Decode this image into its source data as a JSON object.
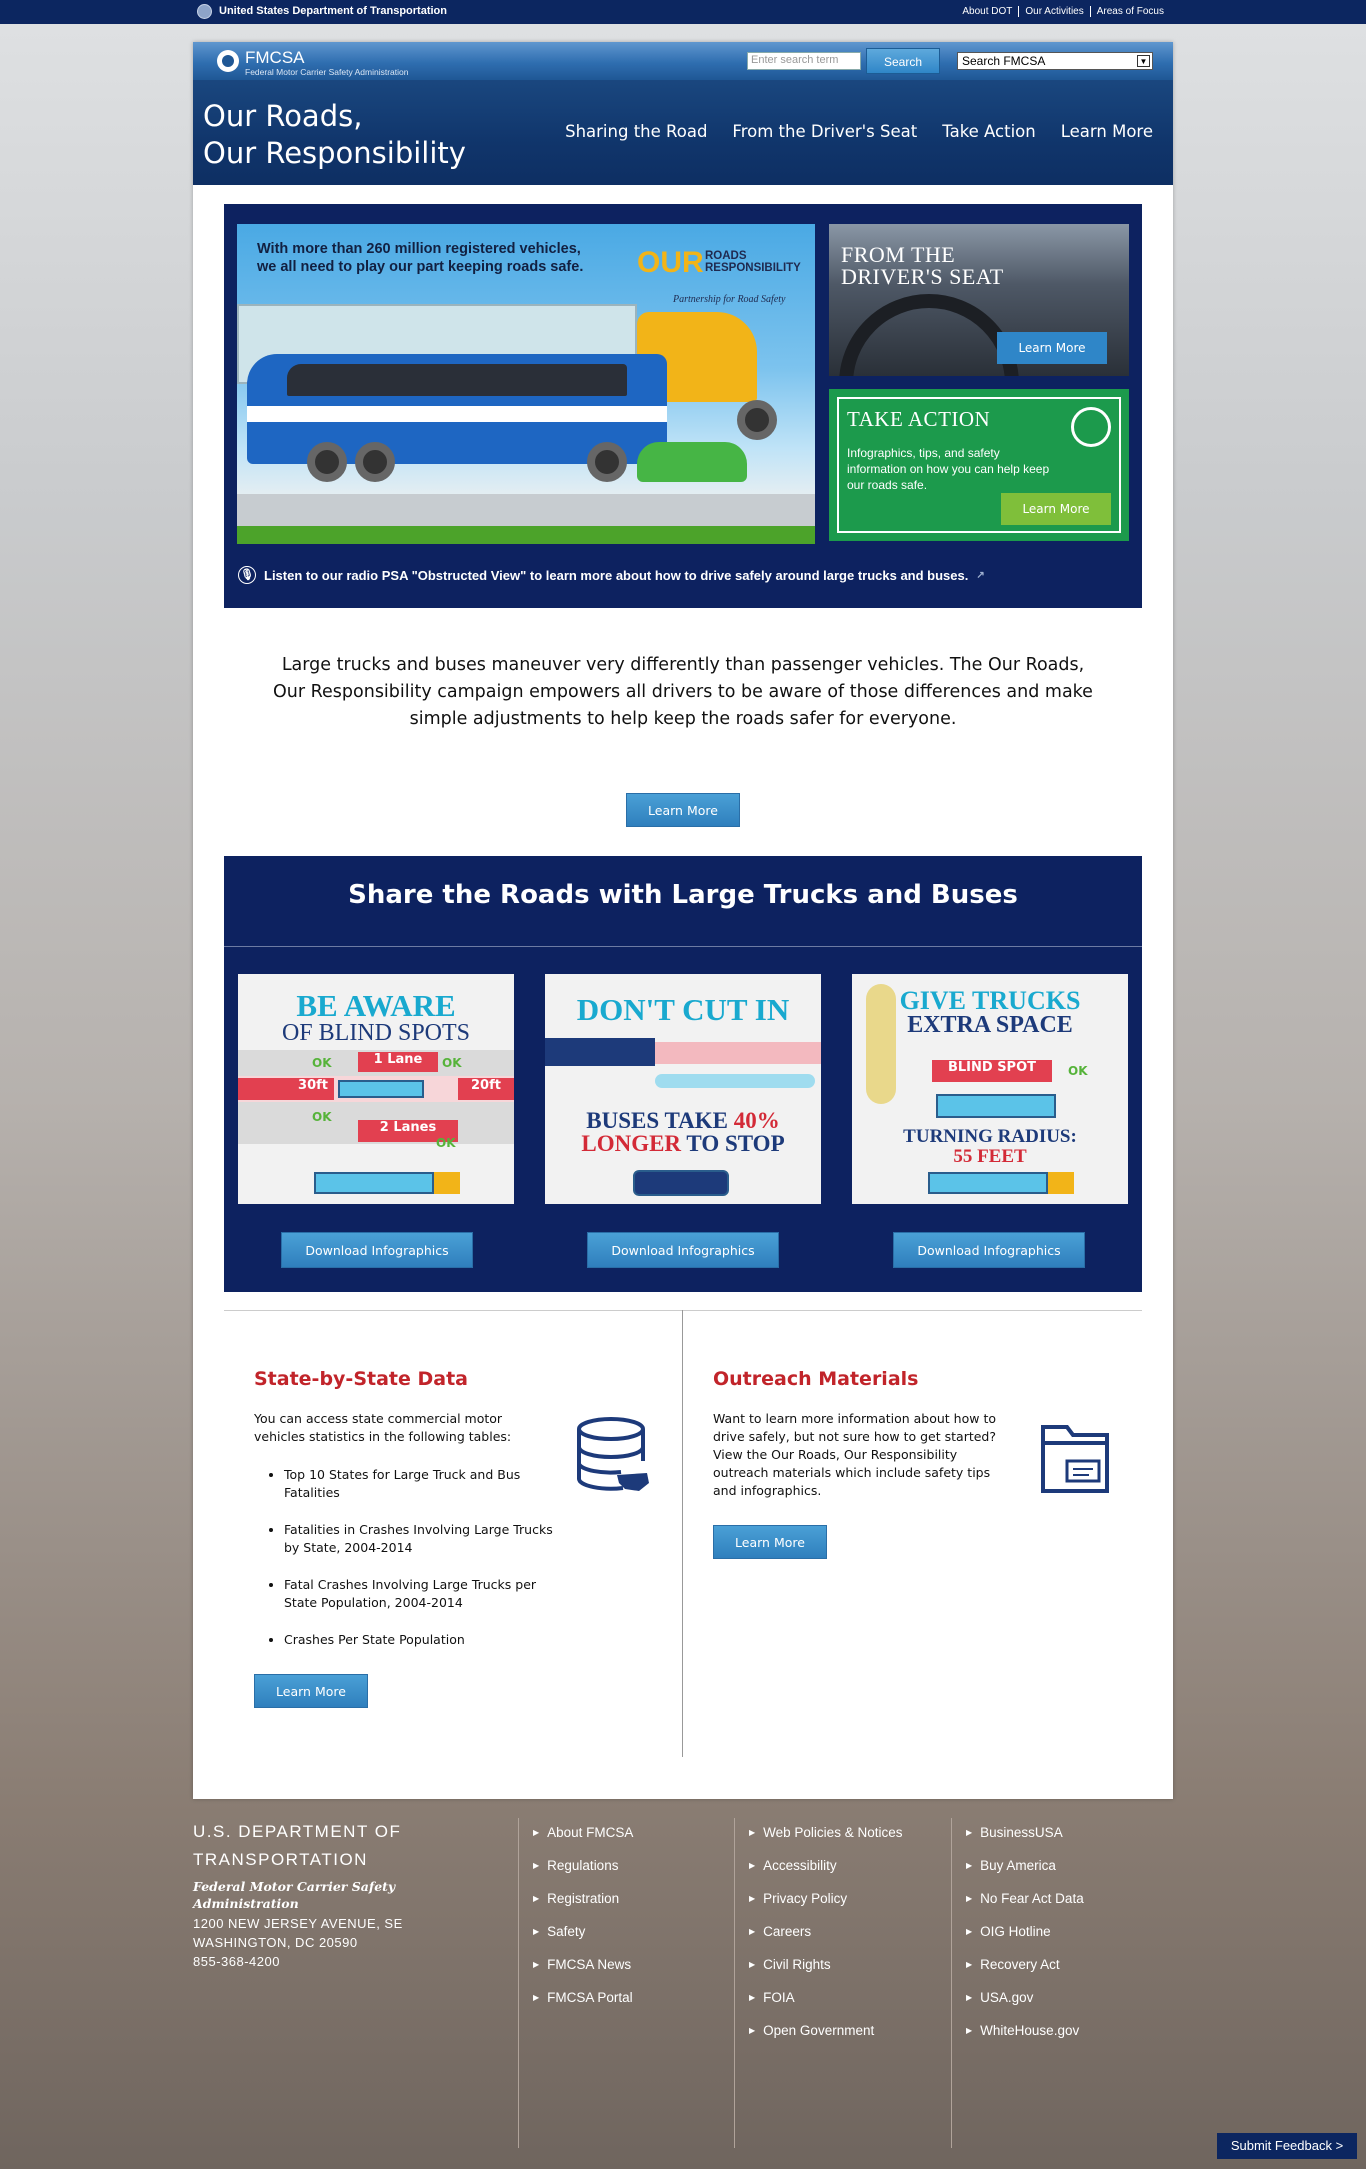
{
  "topbar": {
    "agency": "United States Department of Transportation",
    "links": [
      "About DOT",
      "Our Activities",
      "Areas of Focus"
    ]
  },
  "header": {
    "logo_title": "FMCSA",
    "logo_subtitle": "Federal Motor Carrier Safety Administration",
    "search_placeholder": "Enter search term",
    "search_button": "Search",
    "search_scope": "Search FMCSA"
  },
  "site": {
    "title_line1": "Our Roads,",
    "title_line2": "Our Responsibility"
  },
  "nav": [
    "Sharing the Road",
    "From the Driver's Seat",
    "Take Action",
    "Learn More"
  ],
  "hero": {
    "message_line1": "With more than 260 million registered vehicles,",
    "message_line2": "we all need to play our part keeping roads safe.",
    "badge_our": "OUR",
    "badge_roads": "ROADS",
    "badge_resp": "RESPONSIBILITY",
    "badge_partnership": "Partnership for Road Safety",
    "drivers_seat_title_1": "FROM THE",
    "drivers_seat_title_2": "DRIVER'S SEAT",
    "drivers_seat_button": "Learn More",
    "take_action_title": "TAKE ACTION",
    "take_action_desc": "Infographics, tips, and safety information on how you can help keep our roads safe.",
    "take_action_button": "Learn More",
    "audio_text": "Listen to our radio PSA \"Obstructed View\" to learn more about how to drive safely around large trucks and buses."
  },
  "intro": {
    "text": "Large trucks and buses maneuver very differently than passenger vehicles. The Our Roads, Our Responsibility campaign empowers all drivers to be aware of those differences and make simple adjustments to help keep the roads safer for everyone.",
    "button": "Learn More"
  },
  "share": {
    "title": "Share the Roads with Large Trucks and Buses",
    "cards": [
      {
        "title1": "BE AWARE",
        "title2": "OF BLIND SPOTS",
        "labels": [
          "1 Lane",
          "30ft",
          "20ft",
          "2 Lanes"
        ],
        "ok": "OK",
        "button": "Download Infographics"
      },
      {
        "title1": "DON'T CUT IN",
        "sub1": "BUSES TAKE",
        "sub1b": "40%",
        "sub2a": "LONGER",
        "sub2b": "TO STOP",
        "button": "Download Infographics"
      },
      {
        "title1": "GIVE TRUCKS",
        "title2": "EXTRA SPACE",
        "blind": "BLIND SPOT",
        "ok": "OK",
        "sub1": "TURNING RADIUS:",
        "sub2": "55 FEET",
        "button": "Download Infographics"
      }
    ]
  },
  "state_data": {
    "title": "State-by-State Data",
    "desc": "You can access state commercial motor vehicles statistics in the following tables:",
    "items": [
      "Top 10 States for Large Truck and Bus Fatalities",
      "Fatalities in Crashes Involving Large Trucks by State, 2004-2014",
      "Fatal Crashes Involving Large Trucks per State Population, 2004-2014",
      "Crashes Per State Population"
    ],
    "button": "Learn More"
  },
  "outreach": {
    "title": "Outreach Materials",
    "desc": "Want to learn more information about how to drive safely, but not sure how to get started? View the Our Roads, Our Responsibility outreach materials which include safety tips and infographics.",
    "button": "Learn More"
  },
  "footer": {
    "org_line1": "U.S. DEPARTMENT OF",
    "org_line2": "TRANSPORTATION",
    "sub_line1": "Federal Motor Carrier Safety",
    "sub_line2": "Administration",
    "addr_line1": "1200 NEW JERSEY AVENUE, SE",
    "addr_line2": "WASHINGTON, DC 20590",
    "phone": "855-368-4200",
    "col1": [
      "About FMCSA",
      "Regulations",
      "Registration",
      "Safety",
      "FMCSA News",
      "FMCSA Portal"
    ],
    "col2": [
      "Web Policies & Notices",
      "Accessibility",
      "Privacy Policy",
      "Careers",
      "Civil Rights",
      "FOIA",
      "Open Government"
    ],
    "col3": [
      "BusinessUSA",
      "Buy America",
      "No Fear Act Data",
      "OIG Hotline",
      "Recovery Act",
      "USA.gov",
      "WhiteHouse.gov"
    ]
  },
  "feedback": "Submit Feedback >"
}
